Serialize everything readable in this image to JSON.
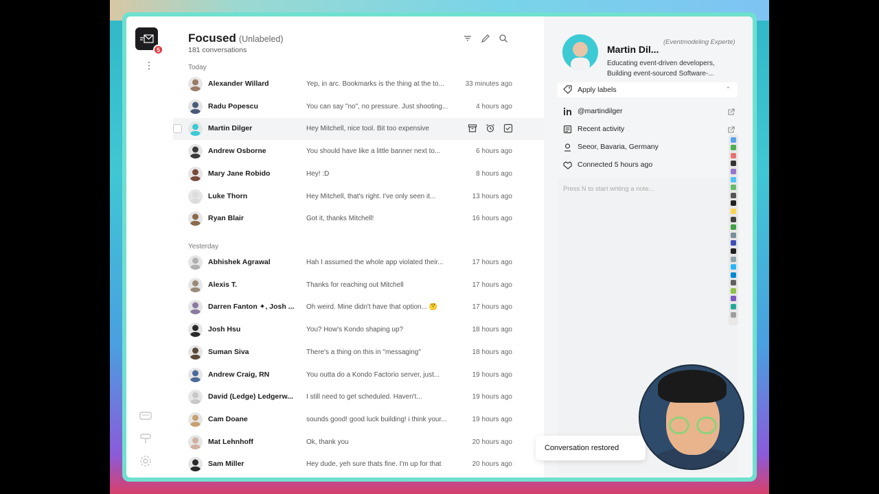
{
  "app": {
    "unread_badge": "5"
  },
  "header": {
    "title": "Focused",
    "subtitle": "(Unlabeled)",
    "count": "181 conversations"
  },
  "groups": {
    "today": "Today",
    "yesterday": "Yesterday"
  },
  "today": [
    {
      "name": "Alexander Willard",
      "preview": "Yep, in arc. Bookmarks is the thing at the to...",
      "time": "33 minutes ago",
      "avatar_color": "#9c7b6a"
    },
    {
      "name": "Radu Popescu",
      "preview": "You can say \"no\", no pressure. Just shooting...",
      "time": "4 hours ago",
      "avatar_color": "#4a5a7a"
    },
    {
      "name": "Martin Dilger",
      "preview": "Hey Mitchell, nice tool. Bit too expensive",
      "time": "",
      "avatar_color": "#3ccad4"
    },
    {
      "name": "Andrew Osborne",
      "preview": "You should have like a little banner next to...",
      "time": "6 hours ago",
      "avatar_color": "#3a3a3a"
    },
    {
      "name": "Mary Jane Robido",
      "preview": "Hey! :D",
      "time": "8 hours ago",
      "avatar_color": "#7a4a3a"
    },
    {
      "name": "Luke Thorn",
      "preview": "Hey Mitchell, that's right. I've only seen it...",
      "time": "13 hours ago",
      "avatar_color": "#dcdcdc"
    },
    {
      "name": "Ryan Blair",
      "preview": "Got it, thanks Mitchell!",
      "time": "16 hours ago",
      "avatar_color": "#8a6a4a"
    }
  ],
  "yesterday": [
    {
      "name": "Abhishek Agrawal",
      "preview": "Hah I assumed the whole app violated their...",
      "time": "17 hours ago",
      "avatar_color": "#b0b0b0"
    },
    {
      "name": "Alexis T.",
      "preview": "Thanks for reaching out Mitchell",
      "time": "17 hours ago",
      "avatar_color": "#9a8a7a"
    },
    {
      "name": "Darren Fanton ✦, Josh ...",
      "preview": "Oh weird. Mine didn't have that option... 🤔",
      "time": "17 hours ago",
      "avatar_color": "#8a7aa0"
    },
    {
      "name": "Josh Hsu",
      "preview": "You? How's Kondo shaping up?",
      "time": "18 hours ago",
      "avatar_color": "#2a2a2a"
    },
    {
      "name": "Suman Siva",
      "preview": "There's a thing on this in \"messaging\"",
      "time": "18 hours ago",
      "avatar_color": "#5a4a3a"
    },
    {
      "name": "Andrew Craig, RN",
      "preview": "You outta do a Kondo Factorio server, just...",
      "time": "19 hours ago",
      "avatar_color": "#4a6a9a"
    },
    {
      "name": "David (Ledge) Ledgerw...",
      "preview": "I still need to get scheduled. Haven't...",
      "time": "19 hours ago",
      "avatar_color": "#c8c8c8"
    },
    {
      "name": "Cam Doane",
      "preview": "sounds good! good luck building! i think your...",
      "time": "19 hours ago",
      "avatar_color": "#c8a070"
    },
    {
      "name": "Mat Lehnhoff",
      "preview": "Ok, thank you",
      "time": "20 hours ago",
      "avatar_color": "#d0b0a0"
    },
    {
      "name": "Sam Miller",
      "preview": "Hey dude, yeh sure thats fine. I'm up for that",
      "time": "20 hours ago",
      "avatar_color": "#2a2a2a"
    }
  ],
  "profile": {
    "name": "Martin Dil...",
    "role": "(Eventmodeling Experte)",
    "bio": "Educating event-driven developers, Building event-sourced Software-...",
    "apply_labels": "Apply labels",
    "linkedin": "@martindilger",
    "recent_activity": "Recent activity",
    "location": "Seeor, Bavaria, Germany",
    "connected": "Connected 5 hours ago",
    "note_placeholder": "Press N to start writing a note..."
  },
  "toast": "Conversation restored"
}
